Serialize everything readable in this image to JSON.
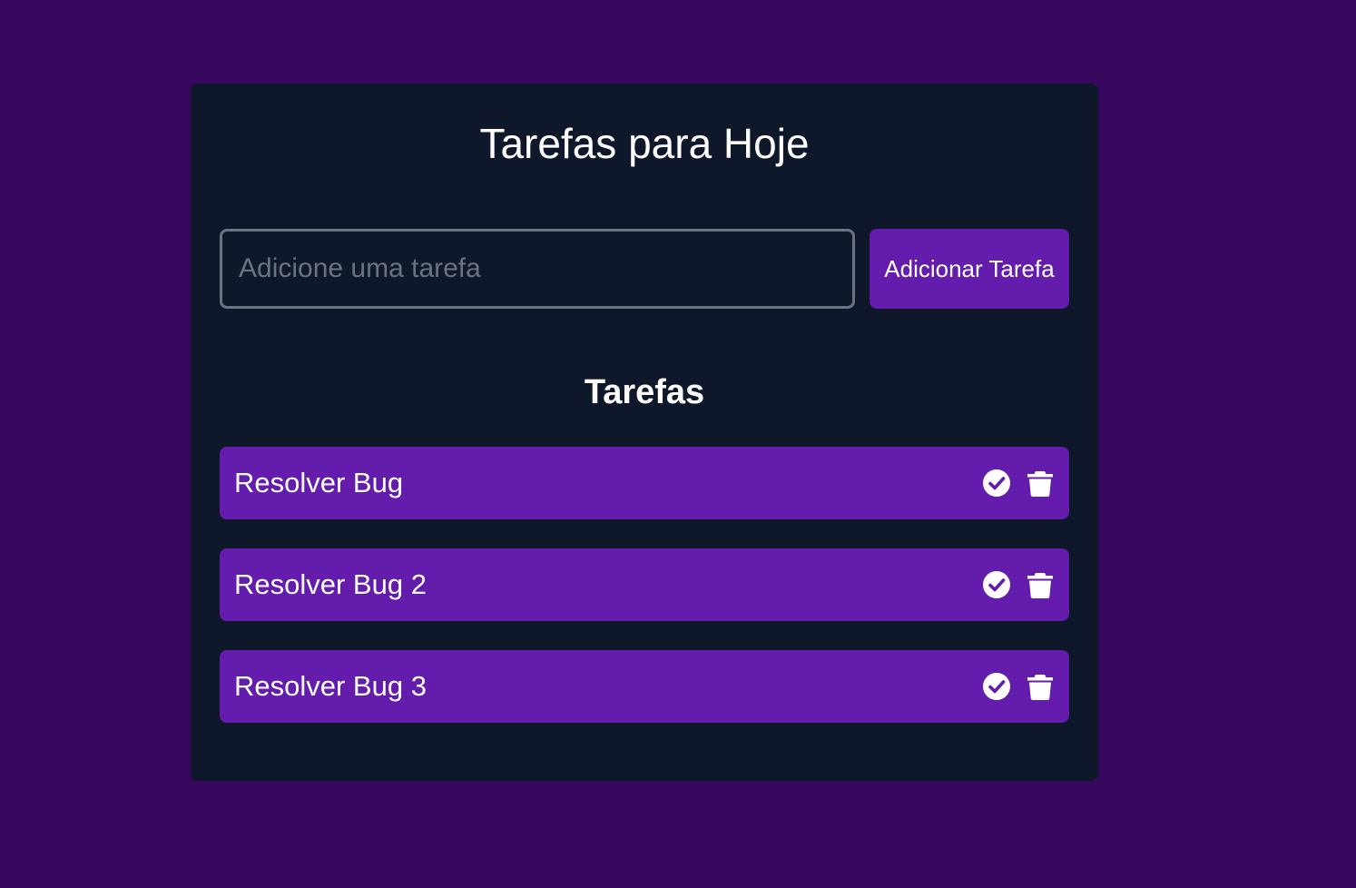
{
  "header": {
    "title": "Tarefas para Hoje"
  },
  "form": {
    "placeholder": "Adicione uma tarefa",
    "value": "",
    "add_label": "Adicionar Tarefa"
  },
  "list": {
    "heading": "Tarefas",
    "items": [
      {
        "label": "Resolver Bug",
        "check_icon": "check-circle-icon",
        "delete_icon": "trash-icon"
      },
      {
        "label": "Resolver Bug 2",
        "check_icon": "check-circle-icon",
        "delete_icon": "trash-icon"
      },
      {
        "label": "Resolver Bug 3",
        "check_icon": "check-circle-icon",
        "delete_icon": "trash-icon"
      }
    ]
  },
  "colors": {
    "page_background": "#36085e",
    "card_background": "#0f172a",
    "accent": "#641cad",
    "input_border": "#6b7280",
    "text": "#ffffff"
  }
}
